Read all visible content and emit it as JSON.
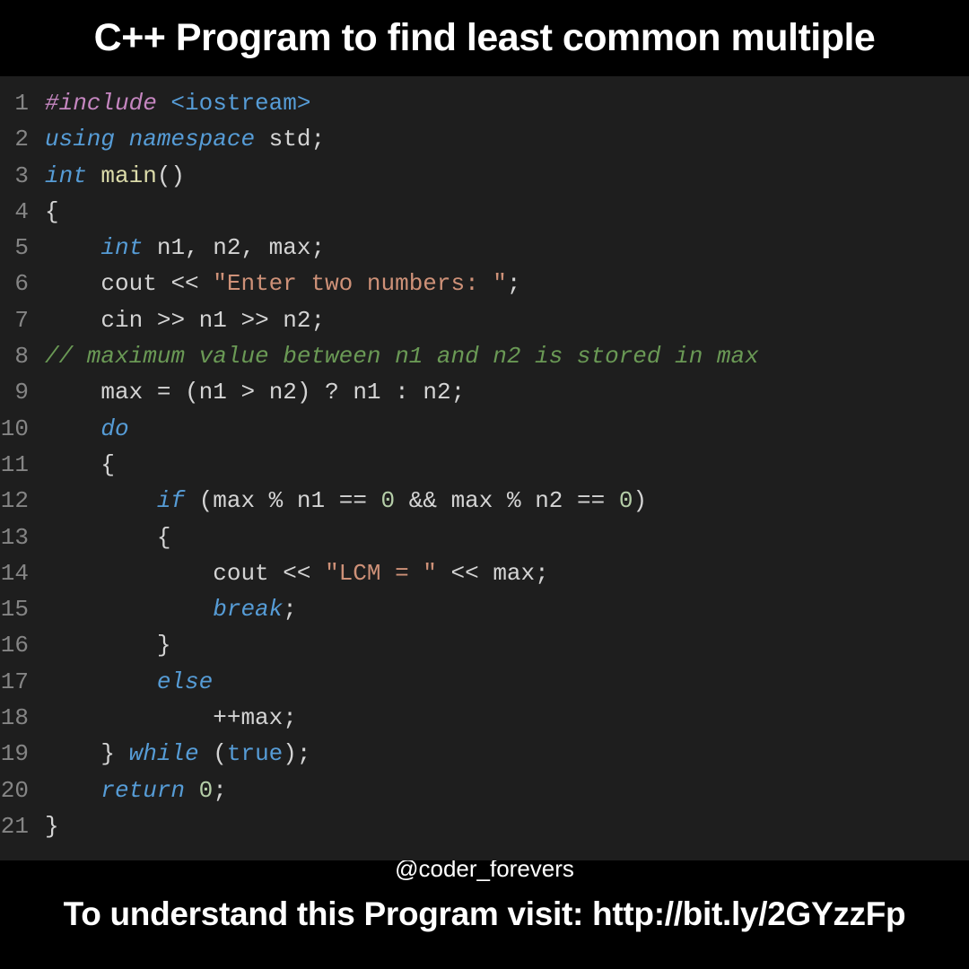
{
  "title": "C++ Program to find least common multiple",
  "handle": "@coder_forevers",
  "footer": "To understand this Program visit: http://bit.ly/2GYzzFp",
  "code": {
    "lines": {
      "l1": {
        "n": "1"
      },
      "l2": {
        "n": "2"
      },
      "l3": {
        "n": "3"
      },
      "l4": {
        "n": "4"
      },
      "l5": {
        "n": "5"
      },
      "l6": {
        "n": "6"
      },
      "l7": {
        "n": "7"
      },
      "l8": {
        "n": "8"
      },
      "l9": {
        "n": "9"
      },
      "l10": {
        "n": "10"
      },
      "l11": {
        "n": "11"
      },
      "l12": {
        "n": "12"
      },
      "l13": {
        "n": "13"
      },
      "l14": {
        "n": "14"
      },
      "l15": {
        "n": "15"
      },
      "l16": {
        "n": "16"
      },
      "l17": {
        "n": "17"
      },
      "l18": {
        "n": "18"
      },
      "l19": {
        "n": "19"
      },
      "l20": {
        "n": "20"
      },
      "l21": {
        "n": "21"
      }
    },
    "t": {
      "include": "#include",
      "iostream": " <iostream>",
      "using": "using",
      "namespace": " namespace",
      "std": " std",
      "semi": ";",
      "int": "int",
      "main": " main",
      "parens": "()",
      "obrace": "{",
      "cbrace": "}",
      "decl_vars": " n1, n2, max",
      "cout": "cout ",
      "cin": "cin ",
      "lshift": "<<",
      "rshift": ">>",
      "prompt_str": " \"Enter two numbers: \"",
      "n1": " n1 ",
      "n2": " n2",
      "n1b": " n1",
      "comment8": "// maximum value between n1 and n2 is stored in max",
      "max_eq": "max = (n1 > n2) ? n1 : n2;",
      "maxv": "max",
      "eq": " = ",
      "open_p": "(",
      "close_p": ")",
      "gt": " > ",
      "tern_q": " ? ",
      "tern_c": " : ",
      "do": "do",
      "if": "if",
      "cond_open": " (",
      "mod": " % ",
      "eqeq": " == ",
      "zero": "0",
      "andand": " && ",
      "lcm_str": " \"LCM = \" ",
      "max_out": " max",
      "break": "break",
      "else": "else",
      "pp_max": "++max;",
      "pp": "++",
      "while": " while",
      "true": "true",
      "return": "return",
      "sp": " ",
      "indent1": "    ",
      "indent2": "        ",
      "indent3": "            ",
      "indent0b": " "
    }
  }
}
